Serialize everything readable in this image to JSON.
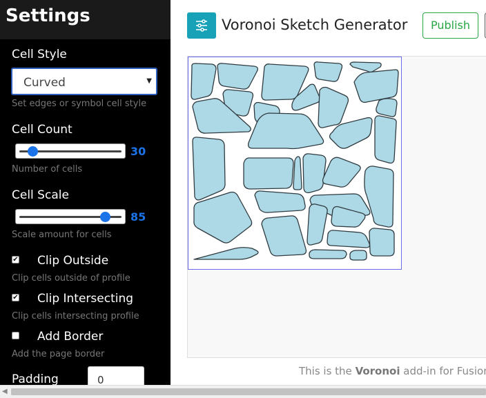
{
  "sidebar": {
    "title": "Settings",
    "cell_style": {
      "label": "Cell Style",
      "selected": "Curved",
      "hint": "Set edges or symbol cell style"
    },
    "cell_count": {
      "label": "Cell Count",
      "value": "30",
      "hint": "Number of cells",
      "fraction": 0.12
    },
    "cell_scale": {
      "label": "Cell Scale",
      "value": "85",
      "hint": "Scale amount for cells",
      "fraction": 0.85
    },
    "clip_outside": {
      "label": "Clip Outside",
      "hint": "Clip cells outside of profile",
      "checked": true
    },
    "clip_intersecting": {
      "label": "Clip Intersecting",
      "hint": "Clip cells intersecting profile",
      "checked": true
    },
    "add_border": {
      "label": "Add Border",
      "hint": "Add the page border",
      "checked": false
    },
    "padding": {
      "label": "Padding",
      "value": "0"
    }
  },
  "header": {
    "icon": "sliders-icon",
    "title": "Voronoi Sketch Generator",
    "publish_label": "Publish"
  },
  "footer": {
    "prefix": "This is the ",
    "bold": "Voronoi",
    "suffix": " add-in for Fusion"
  },
  "colors": {
    "accent": "#1a73e8",
    "cell_fill": "#add8e6",
    "publish": "#28a745",
    "icon_bg": "#17a2b8"
  }
}
